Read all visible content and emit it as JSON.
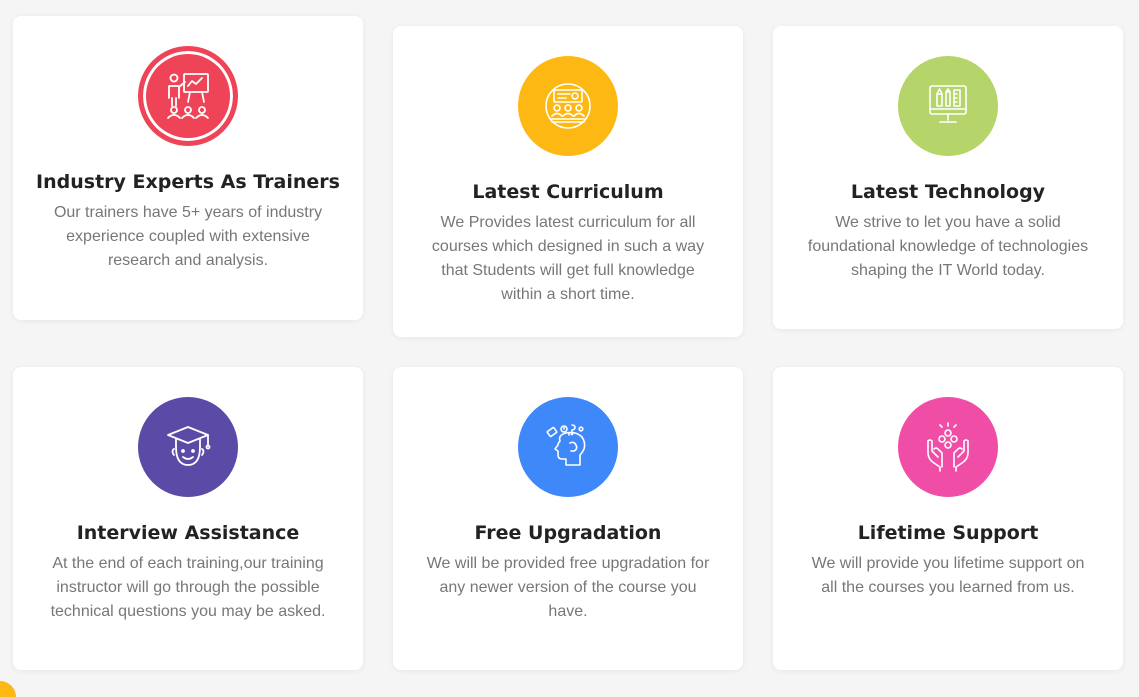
{
  "colors": {
    "page_bg": "#f5f5f5",
    "card_bg": "#ffffff",
    "title": "#222222",
    "text": "#777777",
    "red": "#ef4457",
    "yellow": "#fdb813",
    "green": "#b5d56a",
    "purple": "#5b4ba7",
    "blue": "#3e88fa",
    "pink": "#f04ea6"
  },
  "features": [
    {
      "title": "Industry Experts As Trainers",
      "description": "Our trainers have 5+ years of industry experience coupled with extensive research and analysis.",
      "icon": "trainer-presentation-icon",
      "color": "#ef4457"
    },
    {
      "title": "Latest Curriculum",
      "description": "We Provides latest curriculum for all courses which designed in such a way that Students will get full knowledge within a short time.",
      "icon": "classroom-curriculum-icon",
      "color": "#fdb813"
    },
    {
      "title": "Latest Technology",
      "description": "We strive to let you have a solid foundational knowledge of technologies shaping the IT World today.",
      "icon": "monitor-tools-icon",
      "color": "#b5d56a"
    },
    {
      "title": "Interview Assistance",
      "description": "At the end of each training,our training instructor will go through the possible technical questions you may be asked.",
      "icon": "graduate-student-icon",
      "color": "#5b4ba7"
    },
    {
      "title": "Free Upgradation",
      "description": "We will be provided free upgradation for any newer version of the course you have.",
      "icon": "head-thinking-icon",
      "color": "#3e88fa"
    },
    {
      "title": "Lifetime Support",
      "description": "We will provide you lifetime support on all the courses you learned from us.",
      "icon": "hands-support-icon",
      "color": "#f04ea6"
    }
  ]
}
